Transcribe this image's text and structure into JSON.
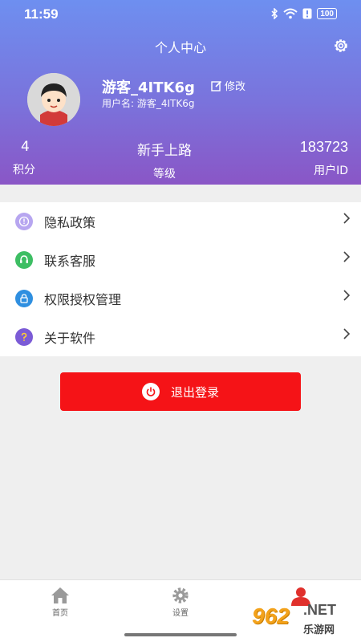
{
  "status_bar": {
    "time": "11:59",
    "battery": "100"
  },
  "header": {
    "title": "个人中心",
    "settings_icon": "gear-icon"
  },
  "profile": {
    "username": "游客_4ITK6g",
    "edit_label": "修改",
    "username_line": "用户名: 游客_4ITK6g"
  },
  "stats": {
    "points_value": "4",
    "points_label": "积分",
    "level_value": "新手上路",
    "level_label": "等级",
    "userid_value": "183723",
    "userid_label": "用户ID"
  },
  "menu": {
    "items": [
      {
        "label": "隐私政策",
        "icon": "privacy-icon",
        "color": "#b7a6f0"
      },
      {
        "label": "联系客服",
        "icon": "customer-service-icon",
        "color": "#3dbe63"
      },
      {
        "label": "权限授权管理",
        "icon": "lock-icon",
        "color": "#2f8fe0"
      },
      {
        "label": "关于软件",
        "icon": "question-icon",
        "color": "#7b5bd6"
      }
    ]
  },
  "logout": {
    "label": "退出登录",
    "color": "#f51317"
  },
  "tabs": [
    {
      "label": "首页",
      "icon": "home-icon"
    },
    {
      "label": "设置",
      "icon": "gear-icon"
    },
    {
      "label": "",
      "icon": "person-icon"
    }
  ],
  "watermark": {
    "number": "962",
    "net": ".NET",
    "site": "乐游网"
  },
  "colors": {
    "header_top": "#6e8ff0",
    "header_bottom": "#8a56c6",
    "background": "#efefef"
  }
}
